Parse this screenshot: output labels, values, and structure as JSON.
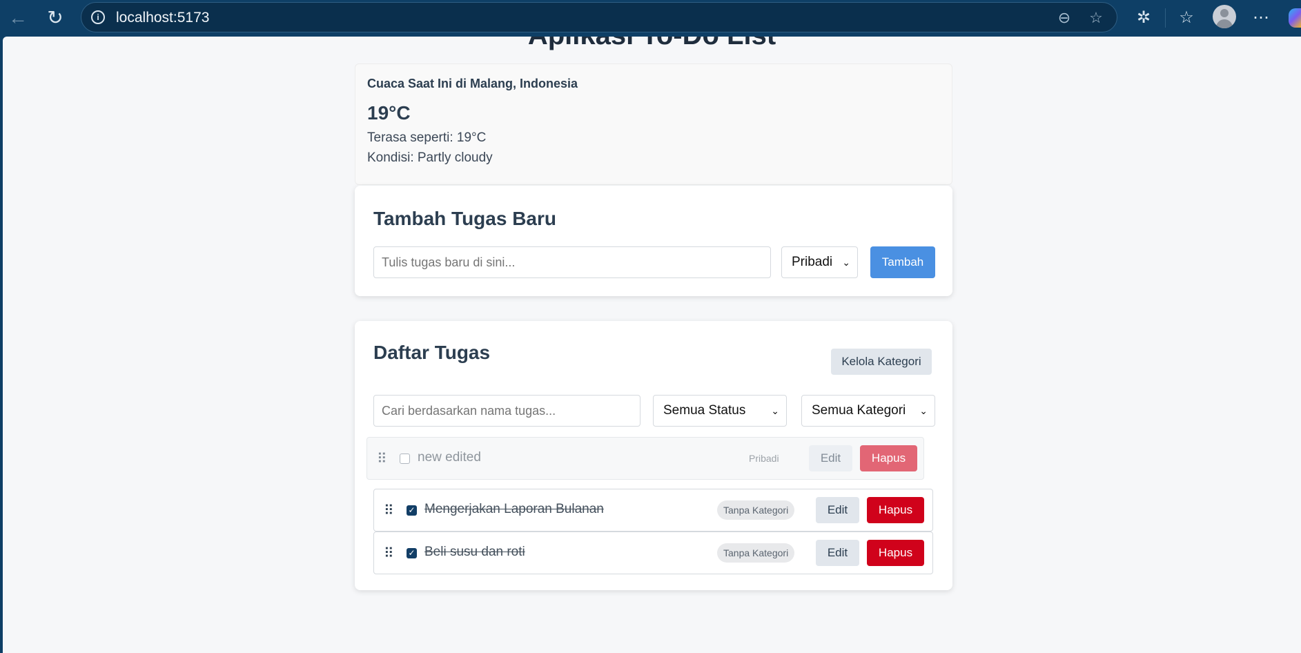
{
  "browser": {
    "url": "localhost:5173"
  },
  "page": {
    "title": "Aplikasi To-Do List"
  },
  "weather": {
    "title": "Cuaca Saat Ini di Malang, Indonesia",
    "temp": "19°C",
    "feels_like": "Terasa seperti: 19°C",
    "condition": "Kondisi: Partly cloudy"
  },
  "add_task": {
    "heading": "Tambah Tugas Baru",
    "input_placeholder": "Tulis tugas baru di sini...",
    "category_selected": "Pribadi",
    "submit_label": "Tambah"
  },
  "task_list": {
    "heading": "Daftar Tugas",
    "manage_label": "Kelola Kategori",
    "search_placeholder": "Cari berdasarkan nama tugas...",
    "status_filter": "Semua Status",
    "category_filter": "Semua Kategori",
    "dragging_item": {
      "title": "new edited",
      "category": "Pribadi",
      "completed": false,
      "edit_label": "Edit",
      "delete_label": "Hapus"
    },
    "items": [
      {
        "title": "Mengerjakan Laporan Bulanan",
        "category": "Tanpa Kategori",
        "completed": true,
        "edit_label": "Edit",
        "delete_label": "Hapus"
      },
      {
        "title": "Beli susu dan roti",
        "category": "Tanpa Kategori",
        "completed": true,
        "edit_label": "Edit",
        "delete_label": "Hapus"
      }
    ]
  },
  "colors": {
    "primary": "#4a90e2",
    "danger": "#d0021b",
    "secondary": "#e1e6ec",
    "chrome": "#0e3f66"
  }
}
